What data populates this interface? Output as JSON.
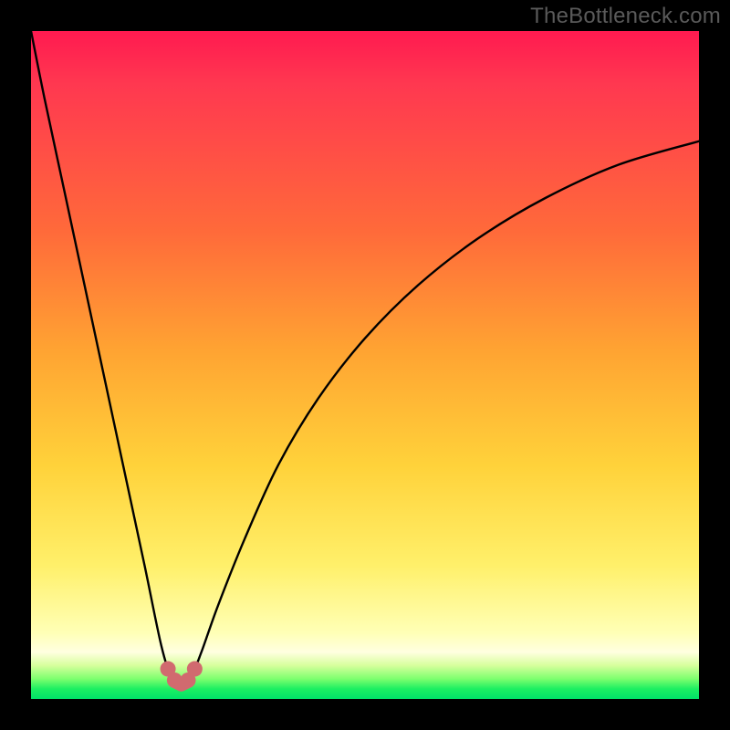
{
  "watermark": {
    "text": "TheBottleneck.com"
  },
  "chart_data": {
    "type": "line",
    "title": "",
    "xlabel": "",
    "ylabel": "",
    "xlim": [
      0,
      1
    ],
    "ylim": [
      0,
      1
    ],
    "series": [
      {
        "name": "bottleneck-curve",
        "note": "V-shaped curve: steep descent from top-left, minimum near x≈0.22, asymptotic rise toward right. Values are y-fraction from top (0=top, 1=bottom).",
        "x": [
          0.0,
          0.02,
          0.05,
          0.08,
          0.11,
          0.14,
          0.17,
          0.195,
          0.21,
          0.225,
          0.24,
          0.255,
          0.28,
          0.32,
          0.37,
          0.43,
          0.5,
          0.58,
          0.67,
          0.77,
          0.88,
          1.0
        ],
        "y": [
          0.0,
          0.1,
          0.24,
          0.38,
          0.52,
          0.66,
          0.8,
          0.92,
          0.965,
          0.975,
          0.965,
          0.93,
          0.86,
          0.76,
          0.65,
          0.55,
          0.46,
          0.38,
          0.31,
          0.25,
          0.2,
          0.165
        ]
      }
    ],
    "markers": {
      "note": "small salmon nodules at the curve trough",
      "color": "#d16a6f",
      "points": [
        {
          "x": 0.205,
          "y": 0.955
        },
        {
          "x": 0.215,
          "y": 0.972
        },
        {
          "x": 0.235,
          "y": 0.972
        },
        {
          "x": 0.245,
          "y": 0.955
        }
      ],
      "bridge": [
        {
          "x": 0.215,
          "y": 0.975
        },
        {
          "x": 0.225,
          "y": 0.98
        },
        {
          "x": 0.235,
          "y": 0.975
        }
      ]
    },
    "gradient_bands": [
      {
        "color": "#ff1a50",
        "stop": 0.0
      },
      {
        "color": "#ff6a3a",
        "stop": 0.3
      },
      {
        "color": "#ffd23a",
        "stop": 0.65
      },
      {
        "color": "#ffffb5",
        "stop": 0.9
      },
      {
        "color": "#1cef62",
        "stop": 0.985
      },
      {
        "color": "#00e268",
        "stop": 1.0
      }
    ]
  }
}
